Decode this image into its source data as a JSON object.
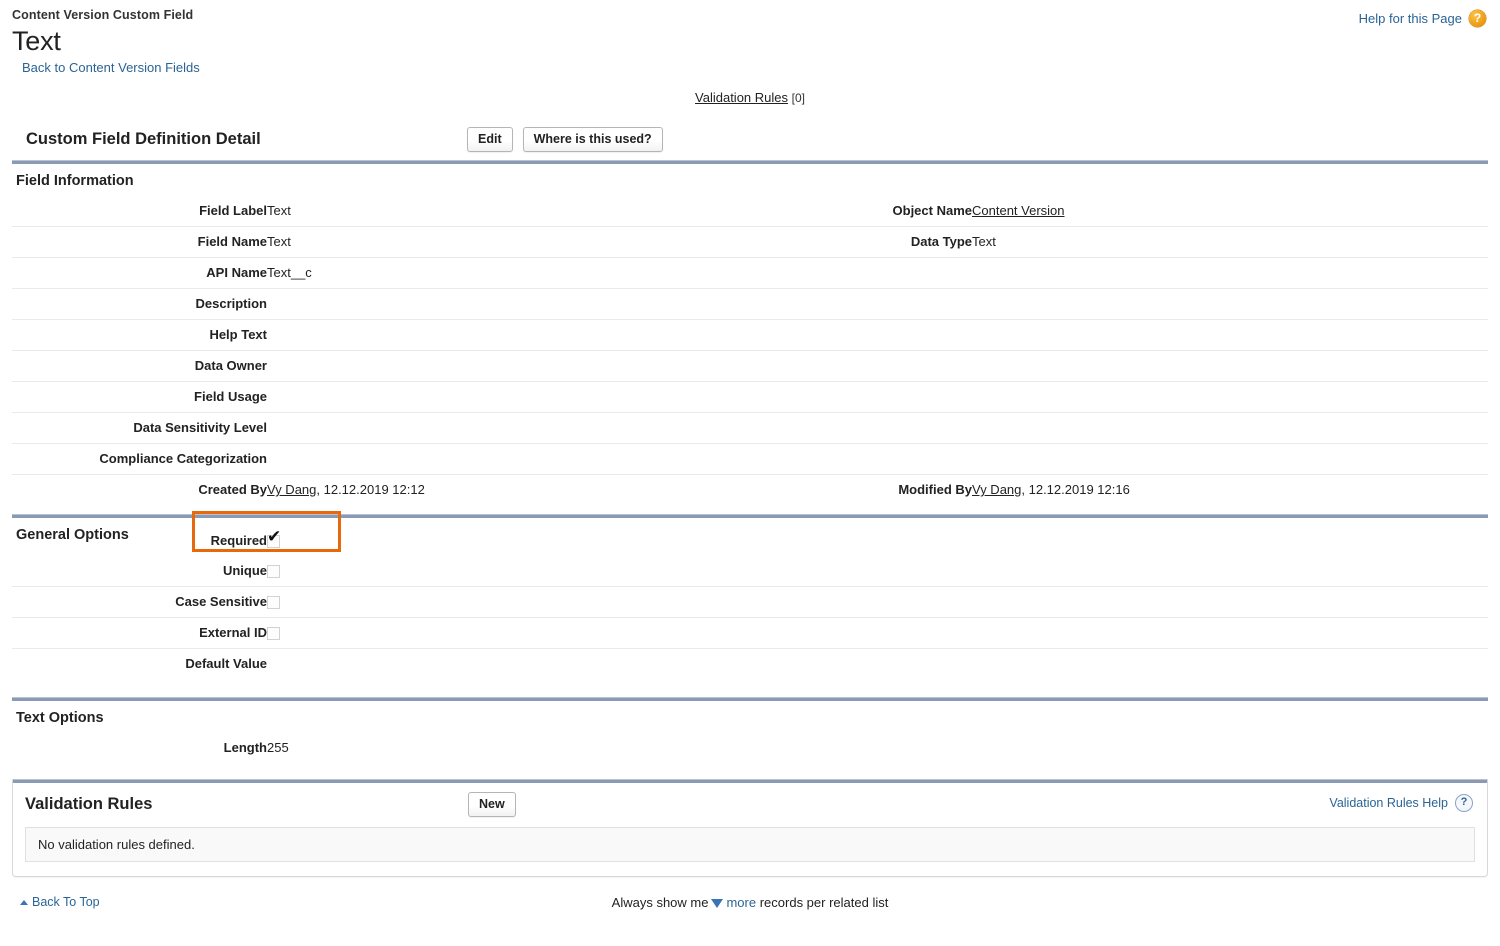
{
  "header": {
    "eyebrow": "Content Version Custom Field",
    "title": "Text",
    "back_link": "Back to Content Version Fields",
    "help_link": "Help for this Page",
    "help_icon": "help-question-orb-icon"
  },
  "related_list_nav": {
    "link": "Validation Rules",
    "count": "[0]"
  },
  "detail": {
    "title": "Custom Field Definition Detail",
    "buttons": [
      {
        "label": "Edit",
        "name": "edit-button"
      },
      {
        "label": "Where is this used?",
        "name": "where-is-this-used-button"
      }
    ]
  },
  "field_information": {
    "section_title": "Field Information",
    "rows": [
      {
        "label": "Field Label",
        "value": "Text",
        "link": false
      },
      {
        "label": "Field Name",
        "value": "Text",
        "link": false
      },
      {
        "label": "API Name",
        "value": "Text__c",
        "link": false
      },
      {
        "label": "Description",
        "value": "",
        "link": false
      },
      {
        "label": "Help Text",
        "value": "",
        "link": false
      },
      {
        "label": "Data Owner",
        "value": "",
        "link": false
      },
      {
        "label": "Field Usage",
        "value": "",
        "link": false
      },
      {
        "label": "Data Sensitivity Level",
        "value": "",
        "link": false
      },
      {
        "label": "Compliance Categorization",
        "value": "",
        "link": false
      },
      {
        "label": "Created By",
        "value_link": "Vy Dang",
        "value_rest": ", 12.12.2019 12:12",
        "link": true
      }
    ],
    "rows_right": [
      {
        "label": "Object Name",
        "value_link": "Content Version",
        "value_rest": "",
        "link": true
      },
      {
        "label": "Data Type",
        "value": "Text",
        "link": false
      },
      {
        "label": "",
        "value": "",
        "link": false
      },
      {
        "label": "",
        "value": "",
        "link": false
      },
      {
        "label": "",
        "value": "",
        "link": false
      },
      {
        "label": "",
        "value": "",
        "link": false
      },
      {
        "label": "",
        "value": "",
        "link": false
      },
      {
        "label": "",
        "value": "",
        "link": false
      },
      {
        "label": "",
        "value": "",
        "link": false
      },
      {
        "label": "Modified By",
        "value_link": "Vy Dang",
        "value_rest": ", 12.12.2019 12:16",
        "link": true
      }
    ]
  },
  "general_options": {
    "section_title": "General Options",
    "rows": [
      {
        "label": "Required",
        "checkbox": true,
        "checked": true,
        "highlighted": true
      },
      {
        "label": "Unique",
        "checkbox": true,
        "checked": false,
        "highlighted": false
      },
      {
        "label": "Case Sensitive",
        "checkbox": true,
        "checked": false,
        "highlighted": false
      },
      {
        "label": "External ID",
        "checkbox": true,
        "checked": false,
        "highlighted": false
      },
      {
        "label": "Default Value",
        "checkbox": false,
        "checked": false,
        "value": "",
        "highlighted": false
      }
    ],
    "highlight_color": "#e8690b"
  },
  "text_options": {
    "section_title": "Text Options",
    "rows": [
      {
        "label": "Length",
        "value": "255"
      }
    ]
  },
  "validation_rules": {
    "section_title": "Validation Rules",
    "new_button": "New",
    "help_link": "Validation Rules Help",
    "help_icon": "help-question-circle-icon",
    "empty_message": "No validation rules defined."
  },
  "footer": {
    "back_to_top": "Back To Top",
    "back_to_top_icon": "caret-up-icon",
    "always_show_prefix": "Always show me",
    "more_link": "more",
    "more_icon": "triangle-down-icon",
    "always_show_suffix": "records per related list"
  }
}
